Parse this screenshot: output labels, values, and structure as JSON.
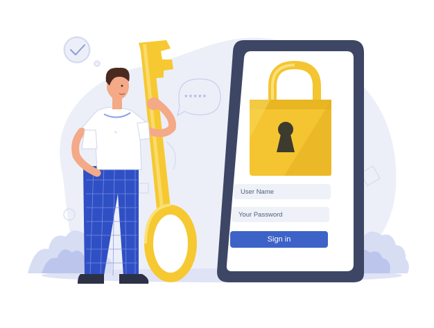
{
  "login_form": {
    "username_placeholder": "User Name",
    "password_placeholder": "Your Password",
    "signin_label": "Sign in"
  },
  "colors": {
    "background_blob": "#e9ecf7",
    "phone_frame": "#3d4664",
    "phone_screen": "#ffffff",
    "lock_gold": "#f4c531",
    "lock_shadow": "#d9a520",
    "key_gold": "#f6c932",
    "accent_blue": "#3e63c8",
    "grass_light": "#d7ddf3",
    "grass_mid": "#bcc6ec",
    "shirt": "#ffffff",
    "pants": "#2f4fc4",
    "hair": "#4a2a1e",
    "skin": "#f4a987"
  },
  "icons": [
    "checkmark-bubble-icon",
    "password-dots-bubble-icon",
    "padlock-icon",
    "key-icon"
  ]
}
